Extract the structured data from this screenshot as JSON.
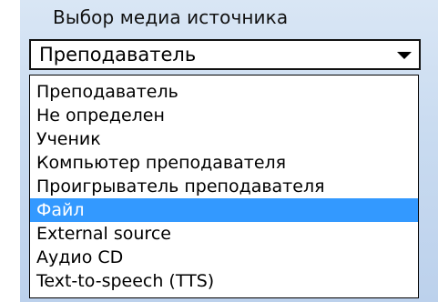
{
  "media_source_panel": {
    "title": "Выбор медиа источника",
    "selected_value": "Преподаватель",
    "dropdown_icon": "chevron-down-icon",
    "options": [
      {
        "label": "Преподаватель",
        "selected": false
      },
      {
        "label": "Не определен",
        "selected": false
      },
      {
        "label": "Ученик",
        "selected": false
      },
      {
        "label": "Компьютер преподавателя",
        "selected": false
      },
      {
        "label": "Проигрыватель преподавателя",
        "selected": false
      },
      {
        "label": "Файл",
        "selected": true
      },
      {
        "label": "External source",
        "selected": false
      },
      {
        "label": "Аудио CD",
        "selected": false
      },
      {
        "label": "Text-to-speech (TTS)",
        "selected": false
      }
    ],
    "colors": {
      "panel_background": "#c9dbf0",
      "highlight": "#3399ff",
      "highlight_text": "#ffffff"
    }
  }
}
